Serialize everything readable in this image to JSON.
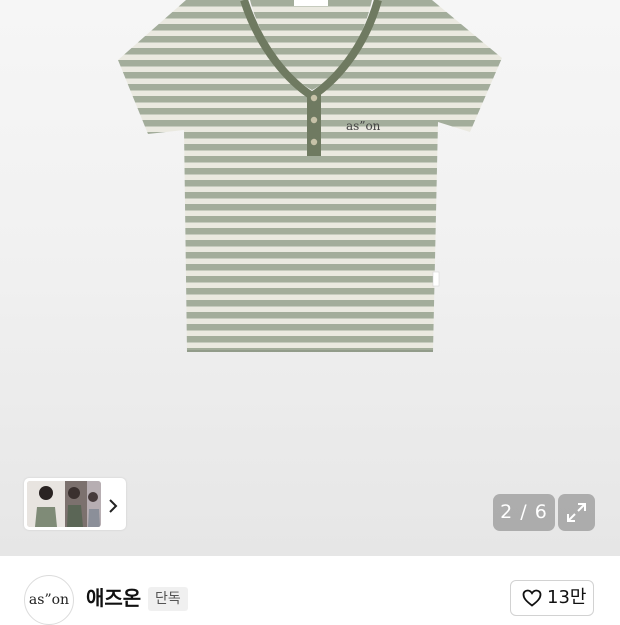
{
  "gallery": {
    "image_counter": "2 / 6",
    "product_logo_text": "as”on",
    "expand_icon": "expand-arrows-icon",
    "thumbnail_arrow_icon": "chevron-right-icon"
  },
  "seller": {
    "logo_text": "as”on",
    "name": "애즈온",
    "badge": "단독",
    "like_icon": "heart-outline-icon",
    "like_count": "13만"
  },
  "colors": {
    "stripe_sage": "#a3ad9b",
    "stripe_cream": "#eae9e0",
    "trim_olive": "#6f7a61",
    "counter_bg": "#969696"
  }
}
